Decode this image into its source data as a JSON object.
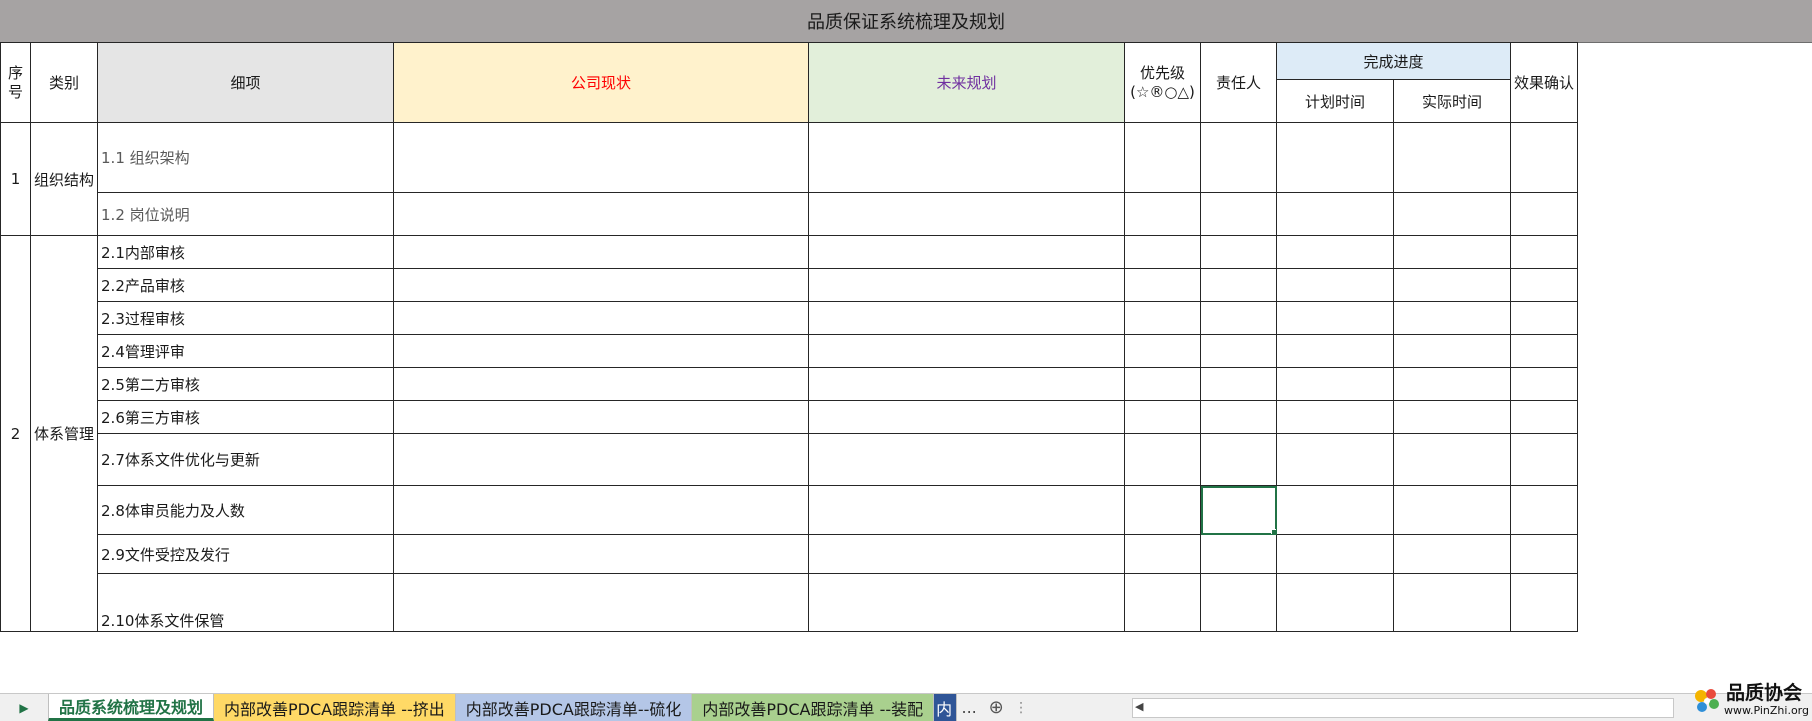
{
  "sheet_title": "品质保证系统梳理及规划",
  "headers": {
    "seq": "序号",
    "category": "类别",
    "detail": "细项",
    "current_status": "公司现状",
    "future_plan": "未来规划",
    "priority": "优先级(☆®○△)",
    "owner": "责任人",
    "progress": "完成进度",
    "plan_time": "计划时间",
    "actual_time": "实际时间",
    "effect_confirm": "效果确认"
  },
  "groups": [
    {
      "seq": "1",
      "category": "组织结构",
      "items": [
        "1.1 组织架构",
        "1.2 岗位说明"
      ]
    },
    {
      "seq": "2",
      "category": "体系管理",
      "items": [
        "2.1内部审核",
        "2.2产品审核",
        "2.3过程审核",
        "2.4管理评审",
        "2.5第二方审核",
        "2.6第三方审核",
        "2.7体系文件优化与更新",
        "2.8体审员能力及人数",
        "2.9文件受控及发行",
        "2.10体系文件保管"
      ]
    }
  ],
  "tabs": [
    {
      "label": "品质系统梳理及规划",
      "active": true
    },
    {
      "label": "内部改善PDCA跟踪清单 --挤出",
      "color": "#ffd966"
    },
    {
      "label": "内部改善PDCA跟踪清单--硫化",
      "color": "#b4c6e7"
    },
    {
      "label": "内部改善PDCA跟踪清单 --装配",
      "color": "#a9d08e"
    },
    {
      "label": "内",
      "color": "#2f5597"
    }
  ],
  "tab_overflow": "...",
  "watermark": {
    "name": "品质协会",
    "url": "www.PinZhi.org"
  }
}
